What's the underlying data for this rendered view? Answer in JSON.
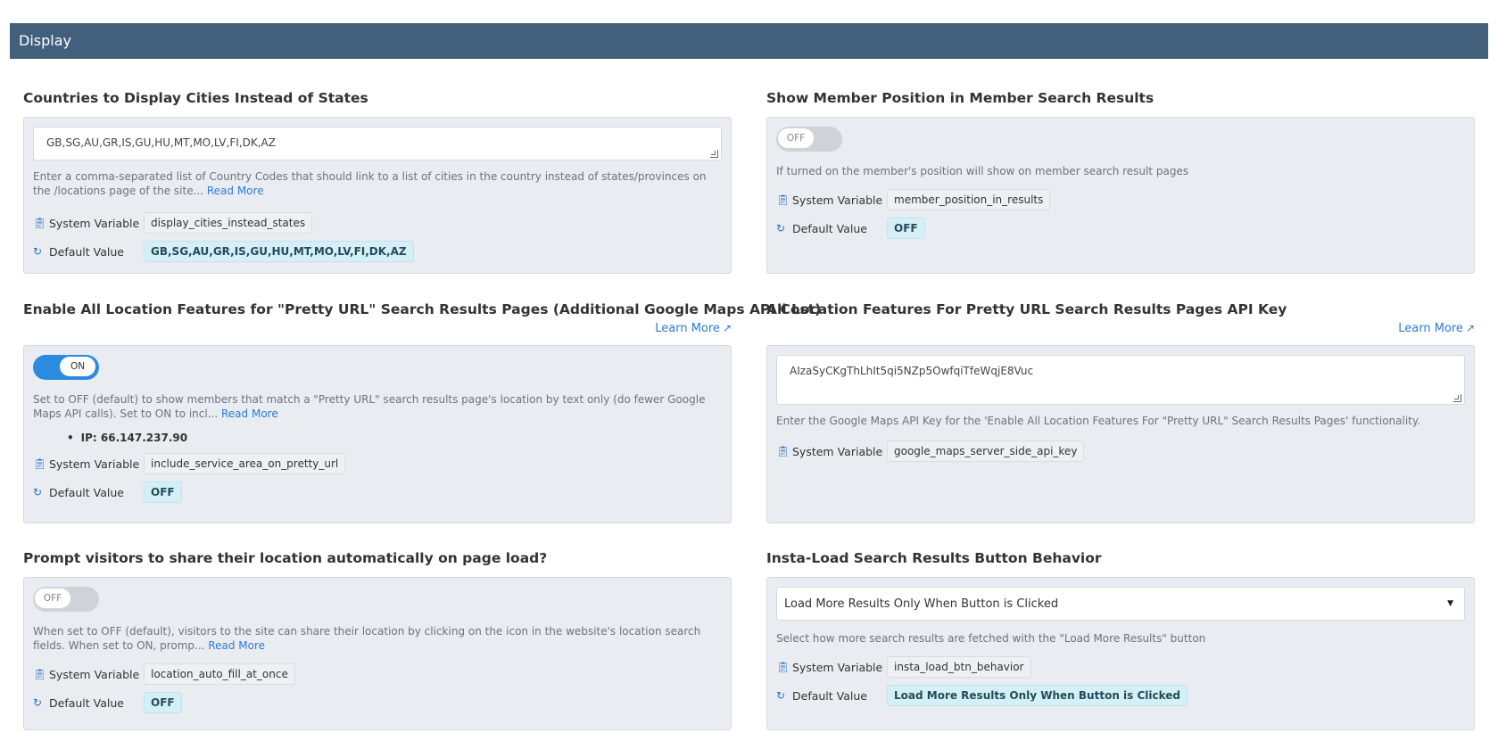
{
  "header": {
    "title": "Display"
  },
  "sections": [
    {
      "title": "Countries to Display Cities Instead of States",
      "field_value": "GB,SG,AU,GR,IS,GU,HU,MT,MO,LV,FI,DK,AZ",
      "help": "Enter a comma-separated list of Country Codes that should link to a list of cities in the country instead of states/provinces on the /locations page of the site...",
      "read_more": "Read More",
      "system_variable_label": "System Variable",
      "system_variable": "display_cities_instead_states",
      "default_label": "Default Value",
      "default_value": "GB,SG,AU,GR,IS,GU,HU,MT,MO,LV,FI,DK,AZ"
    },
    {
      "title": "Show Member Position in Member Search Results",
      "toggle": "OFF",
      "help": "If turned on the member's position will show on member search result pages",
      "system_variable_label": "System Variable",
      "system_variable": "member_position_in_results",
      "default_label": "Default Value",
      "default_value": "OFF"
    },
    {
      "title": "Enable All Location Features for \"Pretty URL\" Search Results Pages (Additional Google Maps API Cost)",
      "learn_more": "Learn More",
      "toggle": "ON",
      "help": "Set to OFF (default) to show members that match a \"Pretty URL\" search results page's location by text only (do fewer Google Maps API calls). Set to ON to incl...",
      "read_more": "Read More",
      "ip": "IP: 66.147.237.90",
      "system_variable_label": "System Variable",
      "system_variable": "include_service_area_on_pretty_url",
      "default_label": "Default Value",
      "default_value": "OFF"
    },
    {
      "title": "All Location Features For Pretty URL Search Results Pages API Key",
      "learn_more": "Learn More",
      "field_value": "AIzaSyCKgThLhIt5qi5NZp5OwfqiTfeWqjE8Vuc",
      "help": "Enter the Google Maps API Key for the 'Enable All Location Features For \"Pretty URL\" Search Results Pages' functionality.",
      "system_variable_label": "System Variable",
      "system_variable": "google_maps_server_side_api_key"
    },
    {
      "title": "Prompt visitors to share their location automatically on page load?",
      "toggle": "OFF",
      "help": "When set to OFF (default), visitors to the site can share their location by clicking on the icon in the website's location search fields.  When set to ON, promp...",
      "read_more": "Read More",
      "system_variable_label": "System Variable",
      "system_variable": "location_auto_fill_at_once",
      "default_label": "Default Value",
      "default_value": "OFF"
    },
    {
      "title": "Insta-Load Search Results Button Behavior",
      "select_value": "Load More Results Only When Button is Clicked",
      "help": "Select how more search results are fetched with the \"Load More Results\" button",
      "system_variable_label": "System Variable",
      "system_variable": "insta_load_btn_behavior",
      "default_label": "Default Value",
      "default_value": "Load More Results Only When Button is Clicked"
    }
  ],
  "icons": {
    "system_variable": "copy-icon",
    "default_value": "refresh-icon",
    "learn_more": "external-link-icon",
    "select": "caret-down-icon"
  }
}
